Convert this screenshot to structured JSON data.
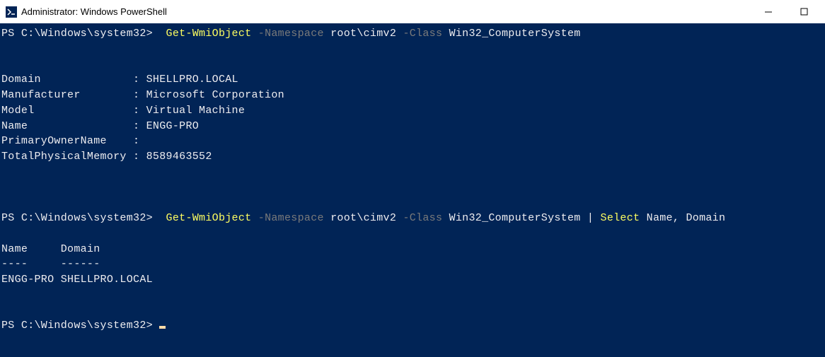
{
  "window": {
    "title": "Administrator: Windows PowerShell"
  },
  "prompt": "PS C:\\Windows\\system32>",
  "cmd1": {
    "cmdlet": "Get-WmiObject",
    "p_ns": "-Namespace",
    "v_ns": "root\\cimv2",
    "p_cl": "-Class",
    "v_cl": "Win32_ComputerSystem"
  },
  "out1": {
    "l1": "Domain              : SHELLPRO.LOCAL",
    "l2": "Manufacturer        : Microsoft Corporation",
    "l3": "Model               : Virtual Machine",
    "l4": "Name                : ENGG-PRO",
    "l5": "PrimaryOwnerName    :",
    "l6": "TotalPhysicalMemory : 8589463552"
  },
  "cmd2": {
    "cmdlet": "Get-WmiObject",
    "p_ns": "-Namespace",
    "v_ns": "root\\cimv2",
    "p_cl": "-Class",
    "v_cl": "Win32_ComputerSystem",
    "pipe": "|",
    "select": "Select",
    "cols": "Name, Domain"
  },
  "out2": {
    "h": "Name     Domain",
    "s": "----     ------",
    "r": "ENGG-PRO SHELLPRO.LOCAL"
  }
}
